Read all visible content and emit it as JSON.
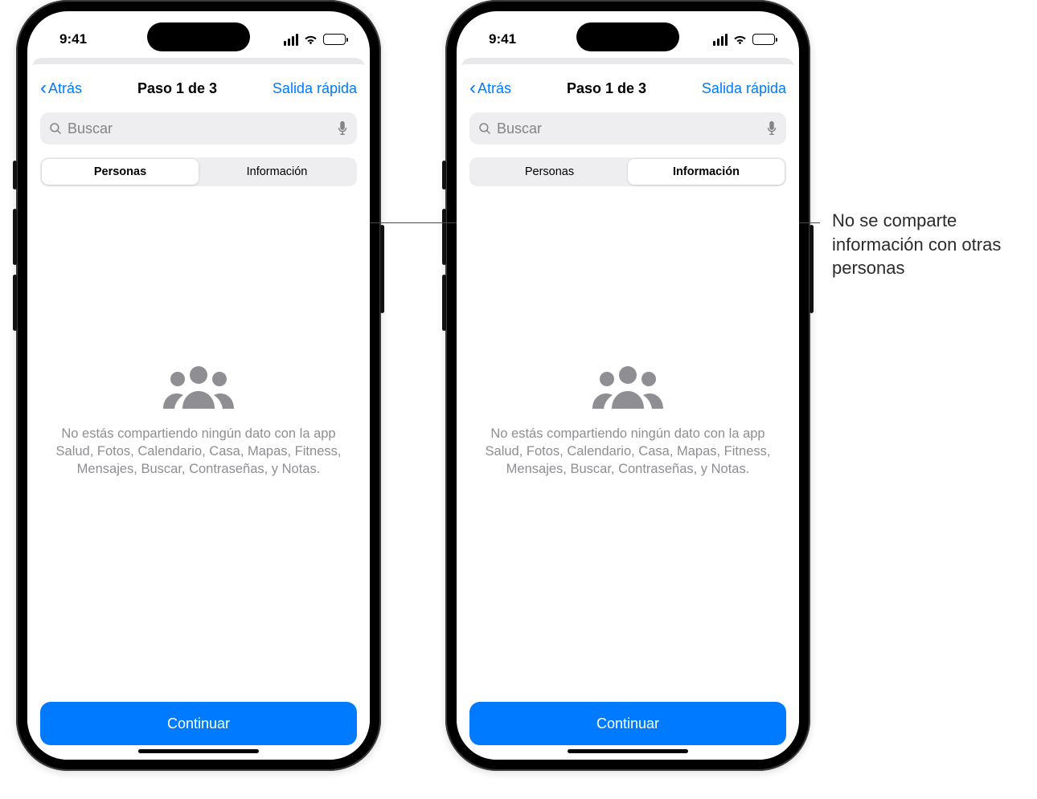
{
  "status": {
    "time": "9:41"
  },
  "nav": {
    "back_label": "Atrás",
    "title": "Paso 1 de 3",
    "quick_exit": "Salida rápida"
  },
  "search": {
    "placeholder": "Buscar"
  },
  "tabs": {
    "people": "Personas",
    "info": "Información"
  },
  "empty": {
    "message": "No estás compartiendo ningún dato con la app Salud, Fotos, Calendario, Casa, Mapas, Fitness, Mensajes, Buscar, Contraseñas, y Notas."
  },
  "buttons": {
    "continue": "Continuar"
  },
  "callout": {
    "text": "No se comparte información con otras personas"
  }
}
